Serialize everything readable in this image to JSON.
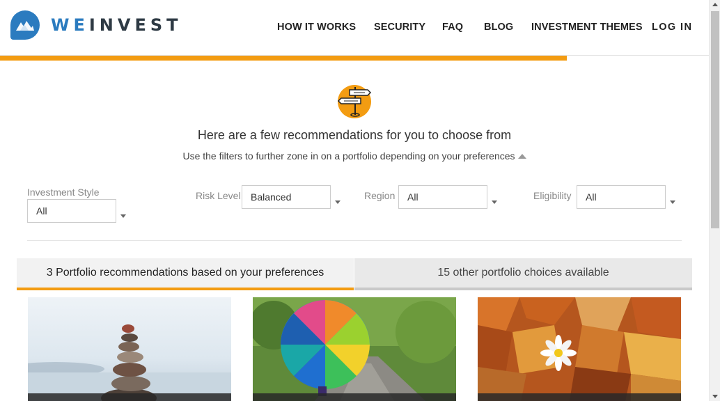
{
  "brand": {
    "name_part1": "WE",
    "name_part2": "INVEST",
    "accent": "#2b7bbf",
    "progress_color": "#f39c12"
  },
  "nav": {
    "items": [
      {
        "label": "HOW IT WORKS"
      },
      {
        "label": "SECURITY"
      },
      {
        "label": "FAQ"
      },
      {
        "label": "BLOG"
      },
      {
        "label": "INVESTMENT THEMES"
      },
      {
        "label": "LOG IN"
      }
    ]
  },
  "progress": {
    "fraction": 0.8
  },
  "hero": {
    "icon": "signpost-icon",
    "title": "Here are a few recommendations for you to choose from",
    "subtitle": "Use the filters to further zone in on a portfolio depending on your preferences"
  },
  "filters": {
    "investment_style": {
      "label": "Investment Style",
      "value": "All"
    },
    "risk_level": {
      "label": "Risk Level",
      "value": "Balanced"
    },
    "region": {
      "label": "Region",
      "value": "All"
    },
    "eligibility": {
      "label": "Eligibility",
      "value": "All"
    }
  },
  "tabs": {
    "recommended": "3 Portfolio recommendations based on your preferences",
    "other": "15 other portfolio choices available"
  },
  "cards": [
    {
      "image": "stacked-stones-image"
    },
    {
      "image": "rainbow-umbrella-image"
    },
    {
      "image": "autumn-leaves-daisy-image"
    }
  ]
}
